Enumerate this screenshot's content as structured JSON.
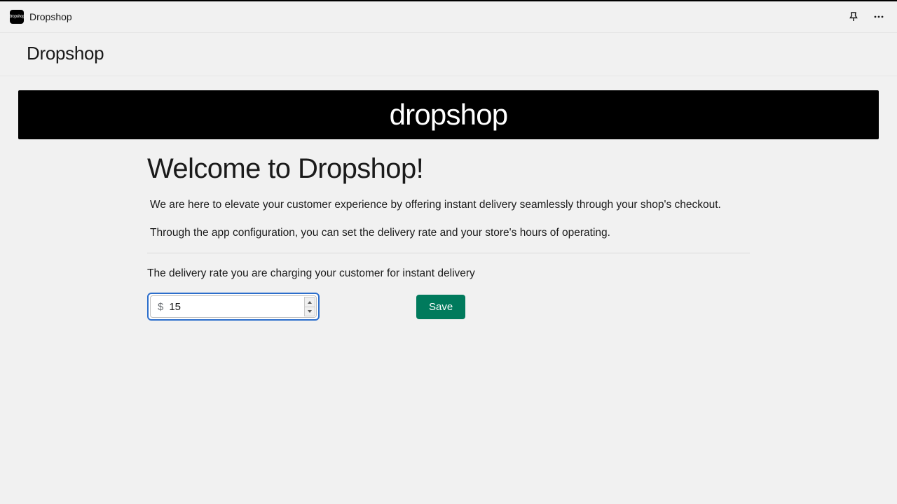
{
  "topbar": {
    "app_name": "Dropshop"
  },
  "page": {
    "title": "Dropshop"
  },
  "hero": {
    "brand": "dropshop"
  },
  "welcome": {
    "title": "Welcome to Dropshop!",
    "p1": "We are here to elevate your customer experience by offering instant delivery seamlessly through your shop's checkout.",
    "p2": "Through the app configuration, you can set the delivery rate and your store's hours of operating."
  },
  "rate": {
    "label": "The delivery rate you are charging your customer for instant delivery",
    "currency_symbol": "$",
    "value": "15",
    "save_label": "Save"
  }
}
